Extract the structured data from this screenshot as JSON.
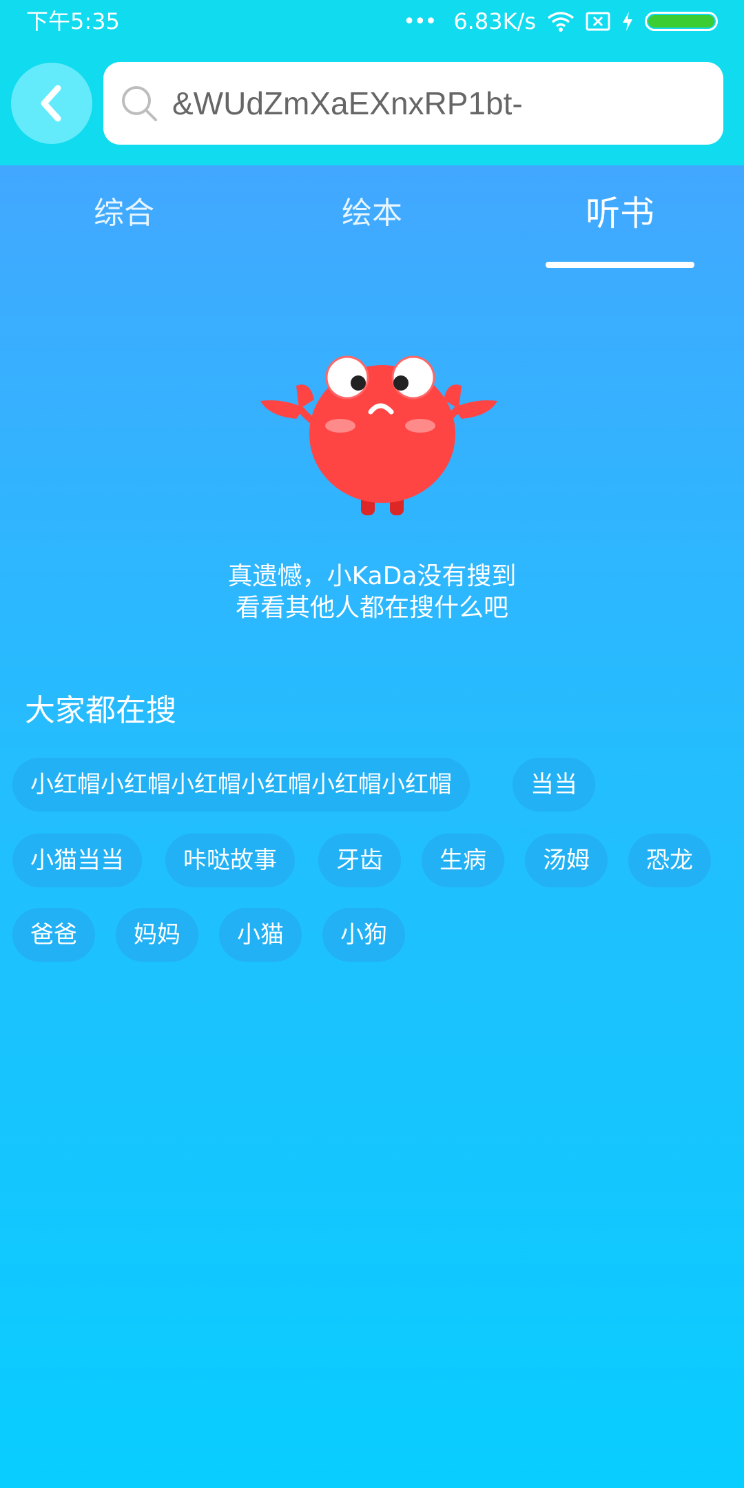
{
  "status_bar": {
    "time": "下午5:35",
    "dots": "•••",
    "speed": "6.83K/s",
    "battery_color": "#3ccd33"
  },
  "header": {
    "back_icon": "chevron-left-icon",
    "search_icon": "search-icon",
    "search_value": "&WUdZmXaEXnxRP1bt-"
  },
  "tabs": [
    {
      "label": "综合",
      "active": false
    },
    {
      "label": "绘本",
      "active": false
    },
    {
      "label": "听书",
      "active": true
    }
  ],
  "empty_state": {
    "mascot": "sad-crab-icon",
    "line1": "真遗憾，小KaDa没有搜到",
    "line2": "看看其他人都在搜什么吧"
  },
  "popular": {
    "title": "大家都在搜",
    "tags": [
      "小红帽小红帽小红帽小红帽小红帽小红帽",
      "当当",
      "小猫当当",
      "咔哒故事",
      "牙齿",
      "生病",
      "汤姆",
      "恐龙",
      "爸爸",
      "妈妈",
      "小猫",
      "小狗"
    ]
  },
  "colors": {
    "top_bar": "#10dbef",
    "back_button": "#64ebfb",
    "tag_bg": "#22b1f4",
    "crab": "#ff4444"
  }
}
